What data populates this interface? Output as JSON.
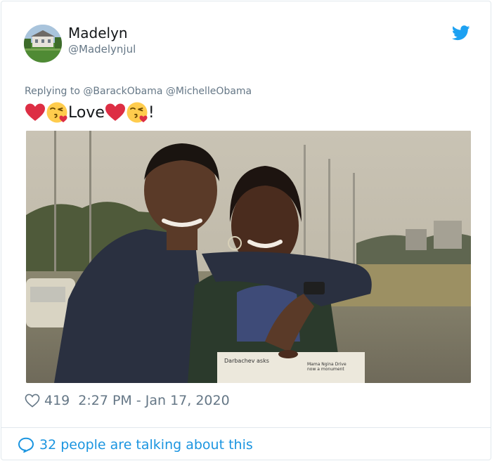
{
  "user": {
    "name": "Madelyn",
    "handle": "@Madelynjul"
  },
  "tweet": {
    "reply_prefix": "Replying to",
    "reply_to": [
      "@BarackObama",
      "@MichelleObama"
    ],
    "text_word": "Love",
    "text_end": "!",
    "likes": "419",
    "timestamp": "2:27 PM - Jan 17, 2020"
  },
  "photo": {
    "newspaper_left": "Darbachev asks",
    "newspaper_right_1": "Mama Ngina Drive",
    "newspaper_right_2": "now a monument"
  },
  "footer": {
    "talking": "32 people are talking about this"
  },
  "colors": {
    "twitter_blue": "#1da1f2",
    "link_blue": "#1b95e0",
    "muted": "#657786",
    "heart_red": "#dd2e44",
    "divider": "#e1e8ed"
  },
  "icons": [
    "twitter-bird-icon",
    "heart-outline-icon",
    "speech-bubble-icon",
    "red-heart-emoji",
    "kiss-face-emoji"
  ]
}
